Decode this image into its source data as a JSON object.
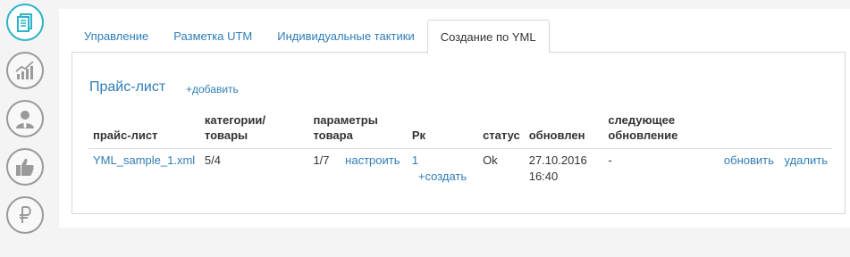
{
  "sidebar": {
    "icons": [
      {
        "name": "documents-icon",
        "active": true
      },
      {
        "name": "chart-growth-icon",
        "active": false
      },
      {
        "name": "user-icon",
        "active": false
      },
      {
        "name": "thumbs-up-icon",
        "active": false
      },
      {
        "name": "ruble-icon",
        "active": false
      }
    ]
  },
  "tabs": [
    {
      "label": "Управление"
    },
    {
      "label": "Разметка UTM"
    },
    {
      "label": "Индивидуальные тактики"
    },
    {
      "label": "Создание по YML"
    }
  ],
  "active_tab": "Создание по YML",
  "panel": {
    "title": "Прайс-лист",
    "add_label": "+добавить"
  },
  "table": {
    "headers": {
      "pricelist": "прайс-лист",
      "categories": "категории/товары",
      "params_line1": "параметры",
      "params_line2": "товара",
      "rk": "Рк",
      "status": "статус",
      "updated": "обновлен",
      "next_line1": "следующее",
      "next_line2": "обновление"
    },
    "rows": [
      {
        "pricelist": "YML_sample_1.xml",
        "categories": "5/4",
        "params": "1/7",
        "configure": "настроить",
        "rk": "1",
        "create": "+создать",
        "status": "Ok",
        "updated_date": "27.10.2016",
        "updated_time": "16:40",
        "next_update": "-",
        "refresh": "обновить",
        "delete": "удалить"
      }
    ]
  },
  "colors": {
    "accent": "#2bb3c8",
    "link": "#2f7db8",
    "icon_gray": "#9a9a9a"
  }
}
